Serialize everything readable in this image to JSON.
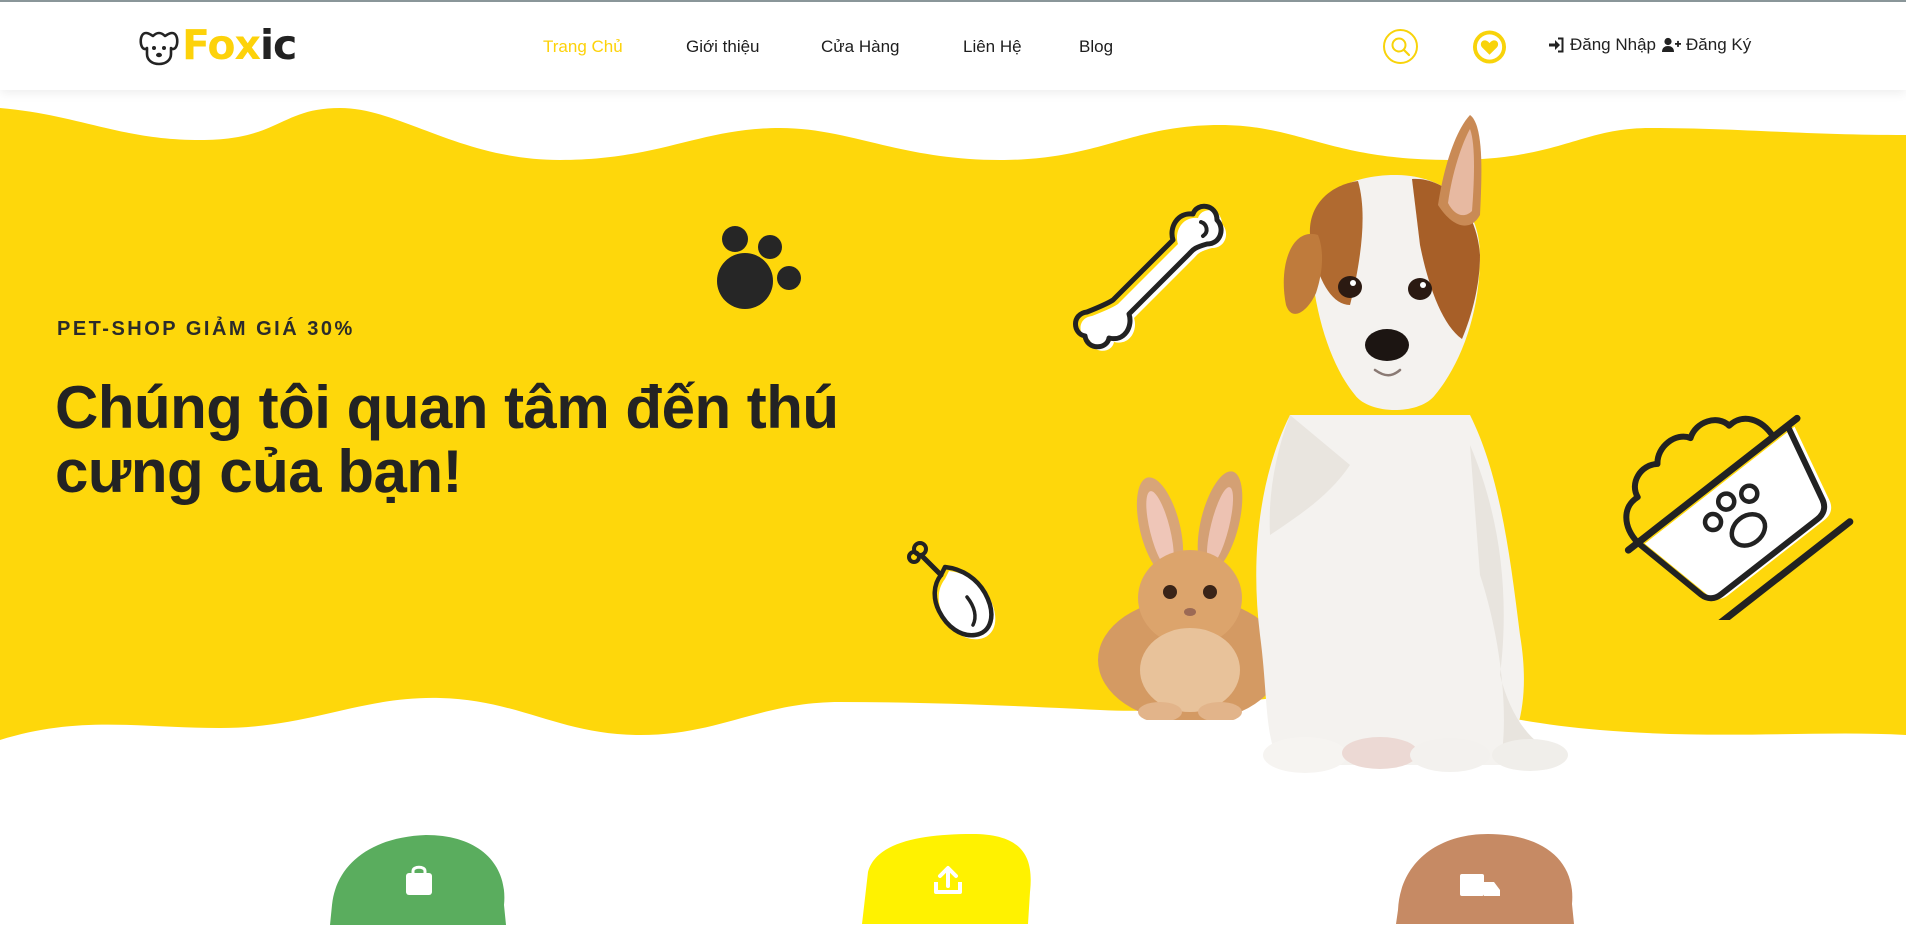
{
  "brand": {
    "part1": "Fox",
    "part2": "ic"
  },
  "nav": {
    "items": [
      {
        "label": "Trang Chủ",
        "active": true
      },
      {
        "label": "Giới thiệu",
        "active": false
      },
      {
        "label": "Cửa Hàng",
        "active": false
      },
      {
        "label": "Liên Hệ",
        "active": false
      },
      {
        "label": "Blog",
        "active": false
      }
    ]
  },
  "header_icons": {
    "search": "search-icon",
    "favorites": "heart-icon"
  },
  "auth": {
    "login_label": "Đăng Nhập",
    "register_label": "Đăng Ký"
  },
  "hero": {
    "kicker": "PET-SHOP GIẢM GIÁ 30%",
    "headline_line1": "Chúng tôi quan tâm đến thú",
    "headline_line2": "cưng của bạn!"
  },
  "features": [
    {
      "icon": "shopping-bag-icon",
      "color": "#5aad5e"
    },
    {
      "icon": "upload-icon",
      "color": "#fff200"
    },
    {
      "icon": "delivery-truck-icon",
      "color": "#c68a64"
    }
  ],
  "colors": {
    "accent": "#fdd20a",
    "hero_bg": "#fed70b",
    "dark": "#222222"
  }
}
